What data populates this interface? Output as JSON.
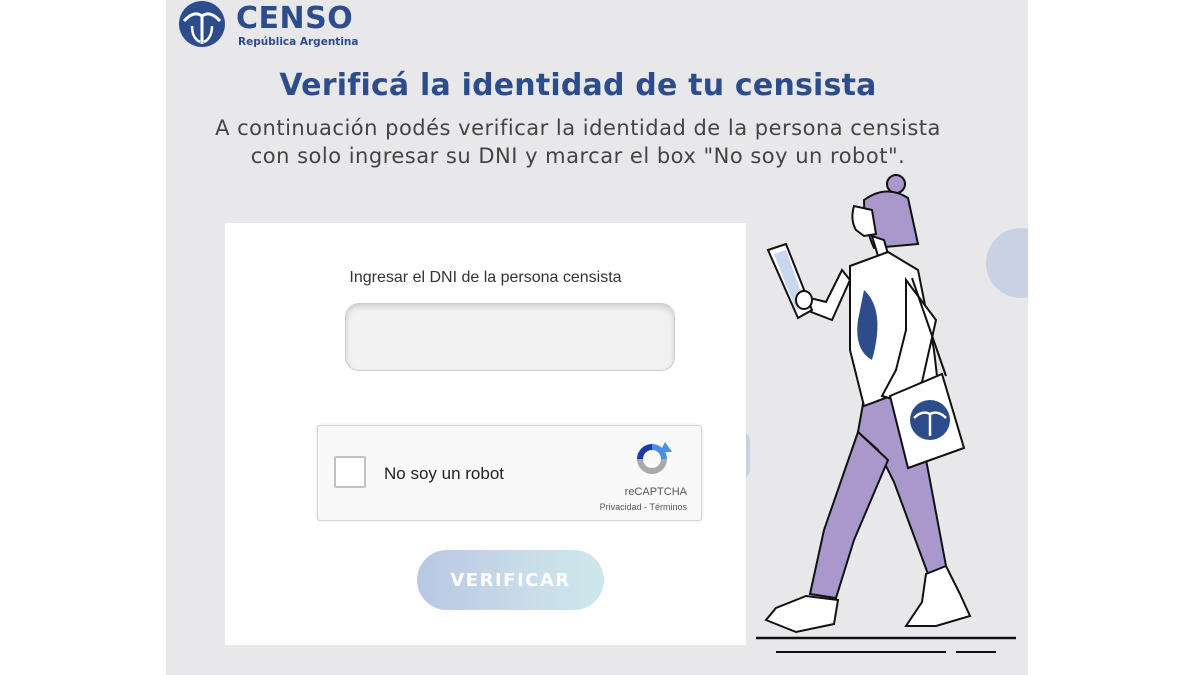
{
  "brand": {
    "title": "CENSO",
    "subtitle": "República Argentina",
    "color": "#2d4c8c"
  },
  "header": {
    "title": "Verificá la identidad de tu censista",
    "subtitle_line1": "A continuación podés verificar la identidad de la persona censista",
    "subtitle_line2": "con solo ingresar su DNI y marcar el box \"No soy un robot\"."
  },
  "form": {
    "dni_label": "Ingresar el DNI de la persona censista",
    "dni_value": "",
    "dni_placeholder": ""
  },
  "captcha": {
    "checkbox_label": "No soy un robot",
    "brand": "reCAPTCHA",
    "links": "Privacidad - Términos",
    "icon": "recaptcha-icon"
  },
  "actions": {
    "verify_label": "VERIFICAR"
  },
  "illustration": {
    "description_icon": "walking-census-worker-illustration",
    "colors": {
      "purple": "#a898cc",
      "navy": "#2d4c8c"
    }
  }
}
